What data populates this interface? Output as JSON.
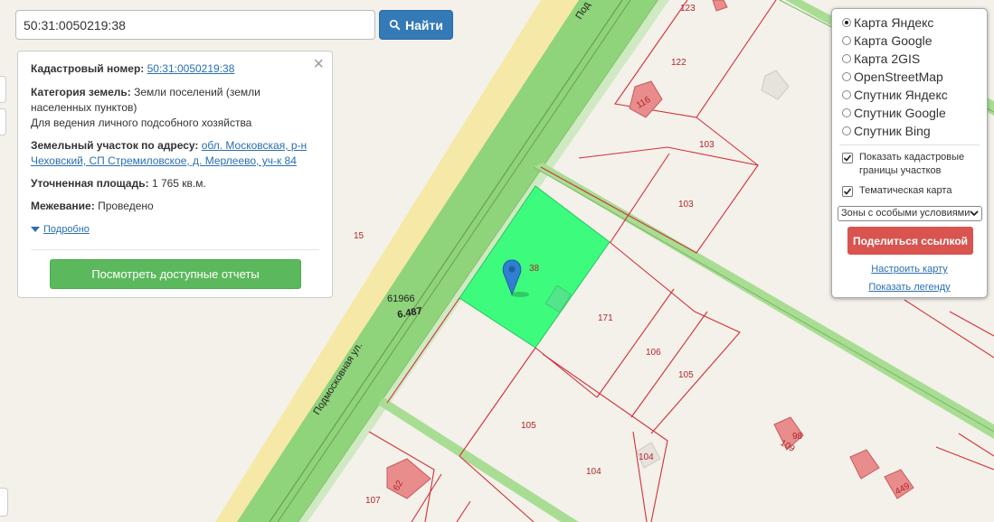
{
  "search": {
    "value": "50:31:0050219:38",
    "button_label": "Найти"
  },
  "info": {
    "cadastral_label": "Кадастровый номер:",
    "cadastral_value": "50:31:0050219:38",
    "category_label": "Категория земель:",
    "category_value": "Земли поселений (земли населенных пунктов)",
    "usage": "Для ведения личного подсобного хозяйства",
    "address_label": "Земельный участок по адресу:",
    "address_value": "обл. Московская, р-н Чеховский, СП Стремиловское, д. Мерлеево, уч-к 84",
    "area_label": "Уточненная площадь:",
    "area_value": "1 765 кв.м.",
    "survey_label": "Межевание:",
    "survey_value": "Проведено",
    "more_link": "Подробно",
    "report_button": "Посмотреть доступные отчеты"
  },
  "layers": {
    "base_maps": [
      "Карта Яндекс",
      "Карта Google",
      "Карта 2GIS",
      "OpenStreetMap",
      "Спутник Яндекс",
      "Спутник Google",
      "Спутник Bing"
    ],
    "selected": "Карта Яндекс",
    "show_borders_label": "Показать кадастровые границы участков",
    "show_borders_checked": true,
    "thematic_label": "Тематическая карта",
    "thematic_checked": true,
    "zone_select_value": "Зоны с особыми условиями",
    "share_button": "Поделиться ссылкой",
    "configure_link": "Настроить карту",
    "legend_link": "Показать легенду"
  },
  "map": {
    "road_name": "Подмосковная ул.",
    "road_name_top": "Под",
    "road_code": "61966",
    "road_length": "6.487",
    "plot_labels": [
      "123",
      "122",
      "116",
      "103",
      "103",
      "15",
      "38",
      "171",
      "106",
      "105",
      "105",
      "104",
      "104",
      "107",
      "62",
      "98",
      "109",
      "449"
    ]
  },
  "colors": {
    "primary": "#337ab7",
    "success": "#5cb85c",
    "danger": "#d9534f",
    "highlight": "#3dfc7d",
    "boundary": "#d3303a",
    "road": "#8fd37a"
  }
}
